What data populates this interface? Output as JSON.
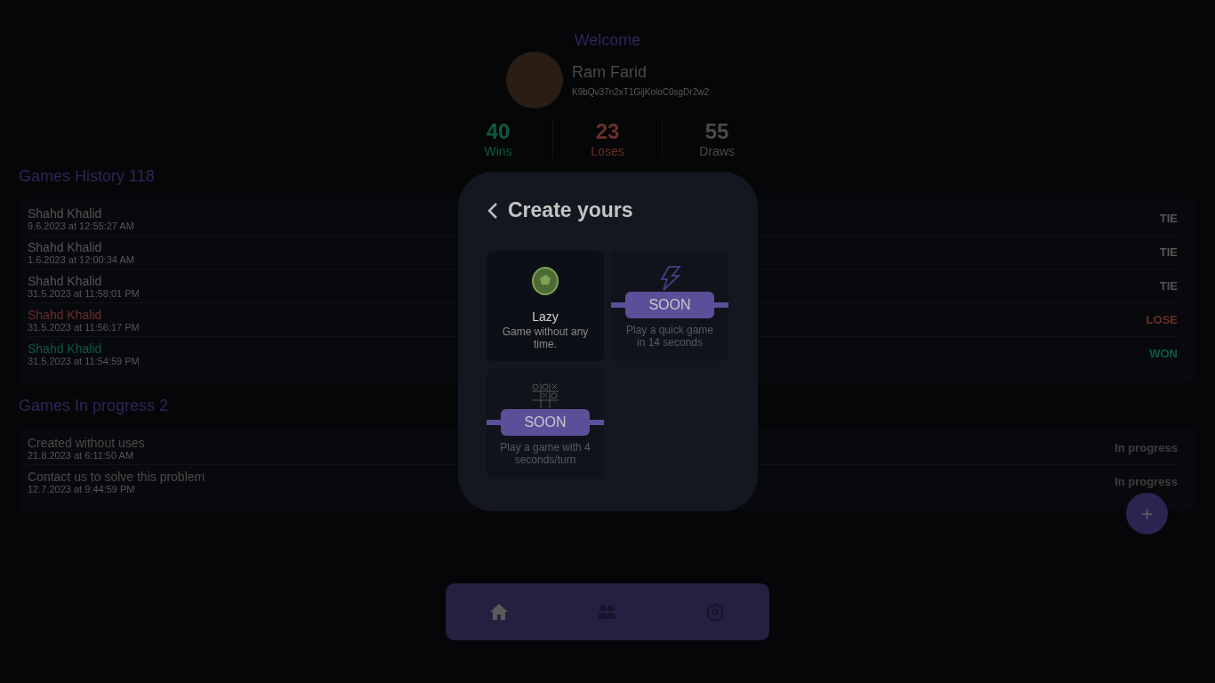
{
  "header": {
    "greeting": "Welcome",
    "name": "Ram Farid",
    "user_id": "K9bQv37n2xT1GijKoloC0sgDr2w2"
  },
  "stats": [
    {
      "kind": "win",
      "value": "40",
      "label": "Wins"
    },
    {
      "kind": "lose",
      "value": "23",
      "label": "Loses"
    },
    {
      "kind": "draw",
      "value": "55",
      "label": "Draws"
    }
  ],
  "history": {
    "title": "Games History 118",
    "rows": [
      {
        "kind": "tie",
        "opponent": "Shahd Khalid",
        "date": "9.6.2023 at 12:55:27 AM",
        "result": "TIE"
      },
      {
        "kind": "tie",
        "opponent": "Shahd Khalid",
        "date": "1.6.2023 at 12:00:34 AM",
        "result": "TIE"
      },
      {
        "kind": "tie",
        "opponent": "Shahd Khalid",
        "date": "31.5.2023 at 11:58:01 PM",
        "result": "TIE"
      },
      {
        "kind": "lose",
        "opponent": "Shahd Khalid",
        "date": "31.5.2023 at 11:56:17 PM",
        "result": "LOSE"
      },
      {
        "kind": "win",
        "opponent": "Shahd Khalid",
        "date": "31.5.2023 at 11:54:59 PM",
        "result": "WON"
      }
    ]
  },
  "in_progress": {
    "title": "Games In progress 2",
    "rows": [
      {
        "title": "Created without uses",
        "date": "21.8.2023 at 6:11:50 AM",
        "status": "In progress"
      },
      {
        "title": "Contact us to solve this problem",
        "date": "12.7.2023 at 9:44:59 PM",
        "status": "In progress"
      }
    ]
  },
  "fab": {
    "label": "+"
  },
  "nav": [
    {
      "kind": "home",
      "selected": true
    },
    {
      "kind": "friends",
      "selected": false
    },
    {
      "kind": "settings",
      "selected": false
    }
  ],
  "modal": {
    "title": "Create yours",
    "modes": [
      {
        "kind": "turtle",
        "title": "Lazy",
        "description": "Game without any time.",
        "disabled": false
      },
      {
        "kind": "bolt",
        "description": "Play a quick game in 14 seconds",
        "disabled": true,
        "badge": "SOON"
      },
      {
        "kind": "grid",
        "description": "Play a game with 4 seconds/turn",
        "disabled": true,
        "badge": "SOON"
      }
    ]
  }
}
